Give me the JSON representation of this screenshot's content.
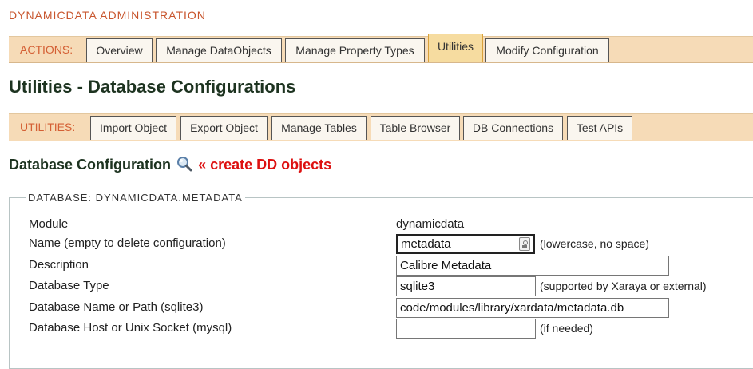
{
  "app": {
    "title": "DYNAMICDATA ADMINISTRATION"
  },
  "actions": {
    "label": "ACTIONS:",
    "tabs": [
      {
        "label": "Overview"
      },
      {
        "label": "Manage DataObjects"
      },
      {
        "label": "Manage Property Types"
      },
      {
        "label": "Utilities",
        "active": true
      },
      {
        "label": "Modify Configuration"
      }
    ]
  },
  "page": {
    "title": "Utilities - Database Configurations"
  },
  "utilities": {
    "label": "UTILITIES:",
    "tabs": [
      {
        "label": "Import Object"
      },
      {
        "label": "Export Object"
      },
      {
        "label": "Manage Tables"
      },
      {
        "label": "Table Browser"
      },
      {
        "label": "DB Connections"
      },
      {
        "label": "Test APIs"
      }
    ]
  },
  "section": {
    "heading": "Database Configuration",
    "search_icon": "magnifier-icon",
    "create_link": "« create DD objects"
  },
  "form": {
    "legend": "DATABASE: DYNAMICDATA.METADATA",
    "module": {
      "label": "Module",
      "value": "dynamicdata"
    },
    "name": {
      "label": "Name (empty to delete configuration)",
      "value": "metadata",
      "hint": "(lowercase, no space)",
      "icon": "password-key-icon"
    },
    "description": {
      "label": "Description",
      "value": "Calibre Metadata"
    },
    "dbtype": {
      "label": "Database Type",
      "value": "sqlite3",
      "hint": "(supported by Xaraya or external)"
    },
    "dbname": {
      "label": "Database Name or Path (sqlite3)",
      "value": "code/modules/library/xardata/metadata.db"
    },
    "dbhost": {
      "label": "Database Host or Unix Socket (mysql)",
      "value": "",
      "hint": "(if needed)"
    }
  },
  "colors": {
    "accent": "#c8552d",
    "tabbar": "#f6dbb7",
    "active_tab": "#f6dca0",
    "link": "#dd1111"
  }
}
